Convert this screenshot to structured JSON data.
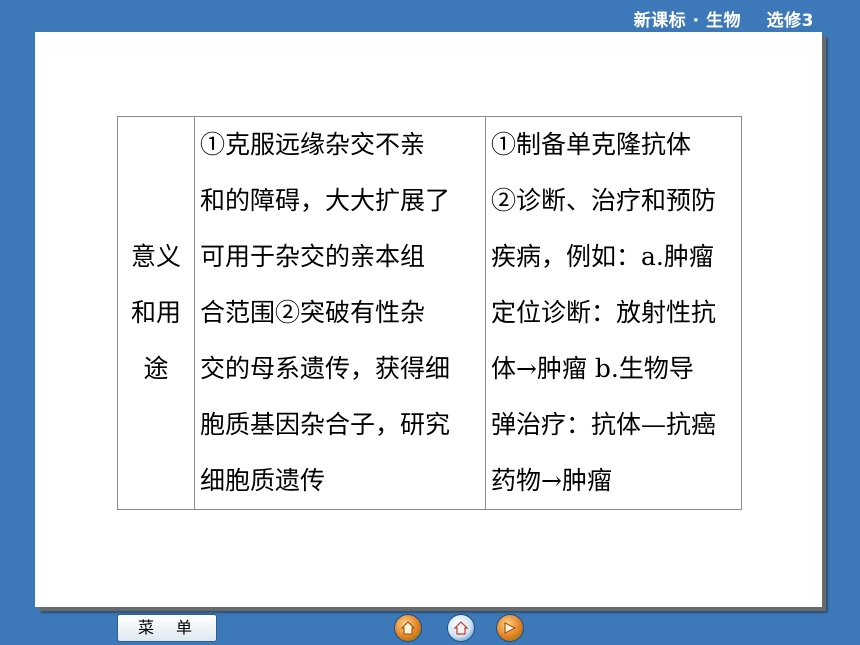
{
  "header": {
    "title": "新课标 · 生物    选修3"
  },
  "table": {
    "row_header": [
      "意义",
      "和用",
      "途"
    ],
    "col2_lines": [
      "①克服远缘杂交不亲",
      "和的障碍，大大扩展了",
      "可用于杂交的亲本组",
      "合范围②突破有性杂",
      "交的母系遗传，获得细",
      "胞质基因杂合子，研究",
      "细胞质遗传"
    ],
    "col3_lines": [
      "①制备单克隆抗体",
      "②诊断、治疗和预防",
      "疾病，例如：a.肿瘤",
      "定位诊断：放射性抗",
      "体→肿瘤 b.生物导",
      "弹治疗：抗体—抗癌",
      "药物→肿瘤"
    ]
  },
  "footer": {
    "menu_label": "菜单",
    "icons": [
      "prev-icon",
      "home-icon",
      "next-icon"
    ]
  }
}
